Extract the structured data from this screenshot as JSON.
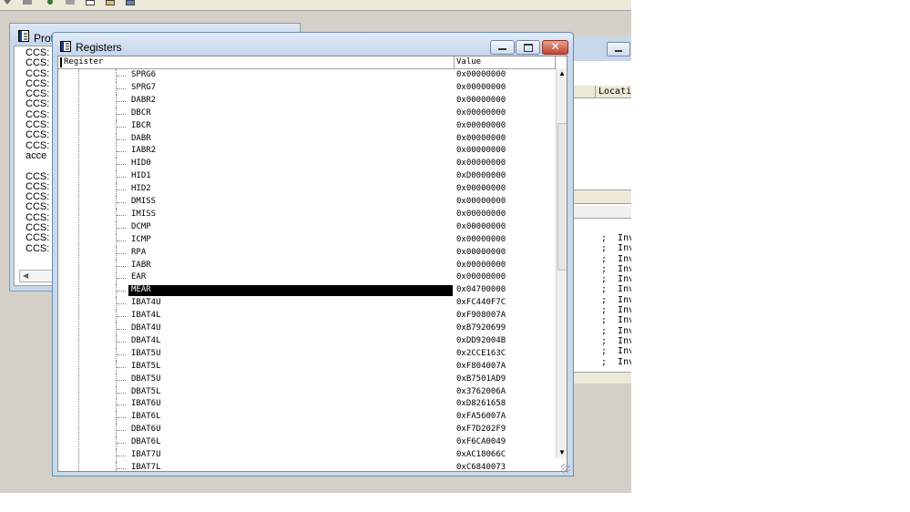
{
  "left_window": {
    "title": "Prof",
    "lines": [
      "CCS:",
      "CCS:",
      "CCS:",
      "CCS:",
      "CCS:",
      "CCS:",
      "CCS:",
      "CCS:",
      "CCS:",
      "CCS:",
      "acce",
      "",
      "CCS:",
      "CCS:",
      "CCS:",
      "CCS:",
      "CCS:",
      "CCS:",
      "CCS:",
      "CCS:"
    ]
  },
  "right_window": {
    "column_header": "Locatio",
    "lines": [
      ";  Inv",
      ";  Inv",
      ";  Inv",
      ";  Inv",
      ";  Inv",
      ";  Inv",
      ";  Inv",
      ";  Inv",
      ";  Inv",
      ";  Inv",
      ";  Inv",
      ";  Inv",
      ";  Inv"
    ]
  },
  "registers_window": {
    "title": "Registers",
    "columns": {
      "register": "Register",
      "value": "Value"
    },
    "close_glyph": "✕",
    "scroll_up": "▲",
    "scroll_down": "▼",
    "selected_register": "MEAR",
    "rows": [
      {
        "name": "SPRG6",
        "value": "0x00000000"
      },
      {
        "name": "SPRG7",
        "value": "0x00000000"
      },
      {
        "name": "DABR2",
        "value": "0x00000000"
      },
      {
        "name": "DBCR",
        "value": "0x00000000"
      },
      {
        "name": "IBCR",
        "value": "0x00000000"
      },
      {
        "name": "DABR",
        "value": "0x00000000"
      },
      {
        "name": "IABR2",
        "value": "0x00000000"
      },
      {
        "name": "HID0",
        "value": "0x00000000"
      },
      {
        "name": "HID1",
        "value": "0xD0000000"
      },
      {
        "name": "HID2",
        "value": "0x00000000"
      },
      {
        "name": "DMISS",
        "value": "0x00000000"
      },
      {
        "name": "IMISS",
        "value": "0x00000000"
      },
      {
        "name": "DCMP",
        "value": "0x00000000"
      },
      {
        "name": "ICMP",
        "value": "0x00000000"
      },
      {
        "name": "RPA",
        "value": "0x00000000"
      },
      {
        "name": "IABR",
        "value": "0x00000000"
      },
      {
        "name": "EAR",
        "value": "0x00000000"
      },
      {
        "name": "MEAR",
        "value": "0x04700000"
      },
      {
        "name": "IBAT4U",
        "value": "0xFC440F7C"
      },
      {
        "name": "IBAT4L",
        "value": "0xF908007A"
      },
      {
        "name": "DBAT4U",
        "value": "0xB7920699"
      },
      {
        "name": "DBAT4L",
        "value": "0xDD92004B"
      },
      {
        "name": "IBAT5U",
        "value": "0x2CCE163C"
      },
      {
        "name": "IBAT5L",
        "value": "0xF804007A"
      },
      {
        "name": "DBAT5U",
        "value": "0xB7501AD9"
      },
      {
        "name": "DBAT5L",
        "value": "0x3762006A"
      },
      {
        "name": "IBAT6U",
        "value": "0xD8261658"
      },
      {
        "name": "IBAT6L",
        "value": "0xFA56007A"
      },
      {
        "name": "DBAT6U",
        "value": "0xF7D202F9"
      },
      {
        "name": "DBAT6L",
        "value": "0xF6CA0049"
      },
      {
        "name": "IBAT7U",
        "value": "0xAC18066C"
      },
      {
        "name": "IBAT7L",
        "value": "0xC6840073"
      }
    ]
  },
  "colors": {
    "caption": "#c9daee",
    "selection": "#000000",
    "close_button": "#c24530"
  }
}
